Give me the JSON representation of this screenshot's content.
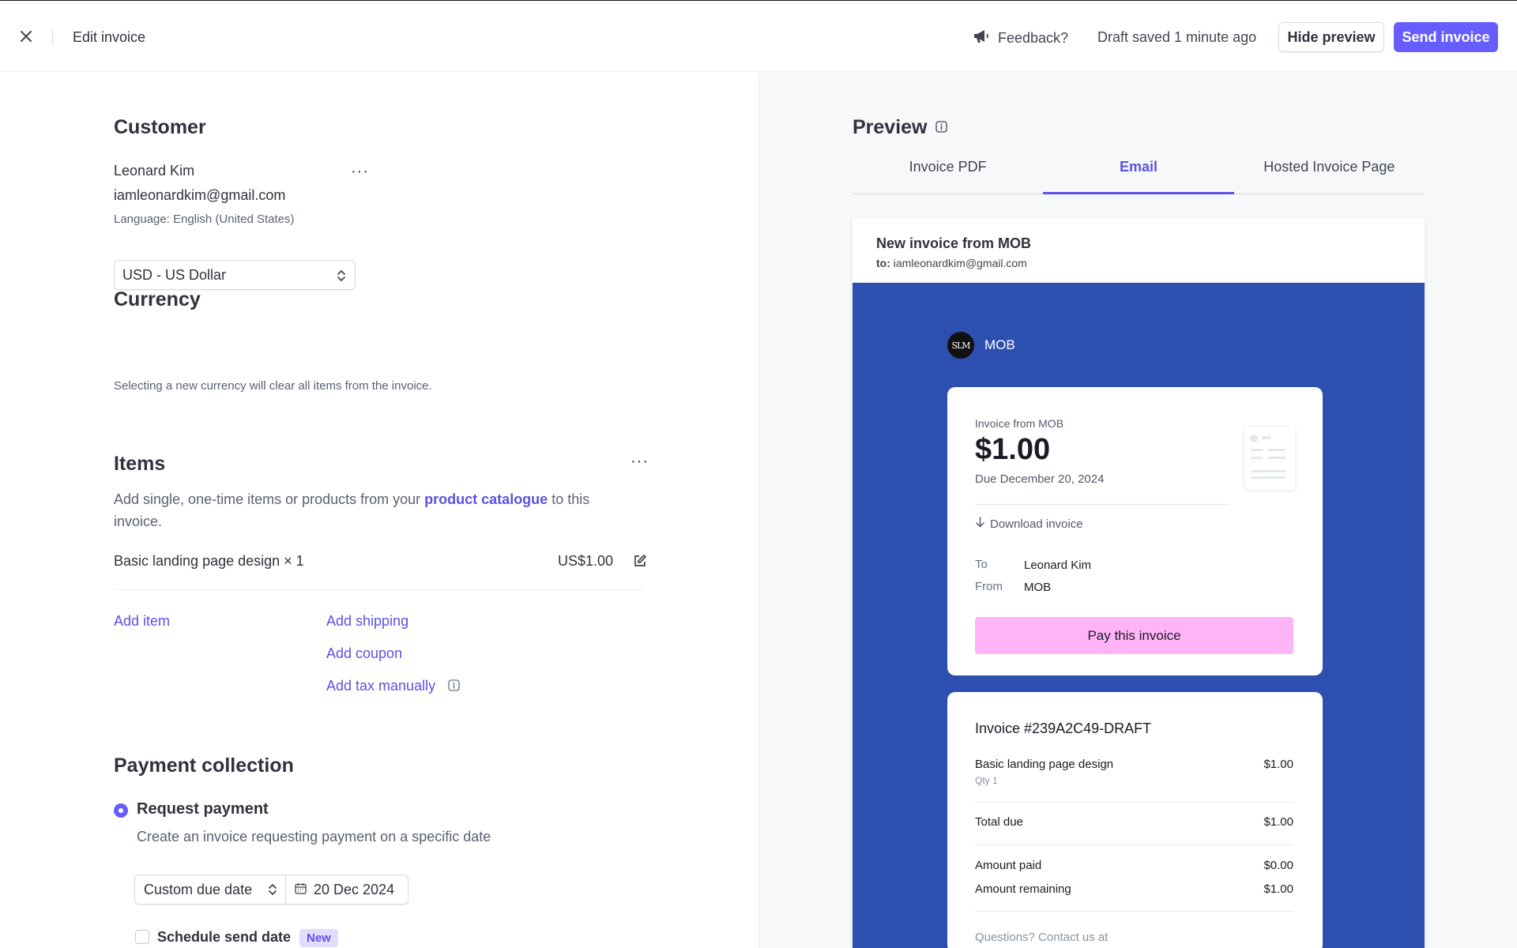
{
  "header": {
    "title": "Edit invoice",
    "feedback_label": "Feedback?",
    "draft_status": "Draft saved 1 minute ago",
    "hide_preview_label": "Hide preview",
    "send_invoice_label": "Send invoice"
  },
  "customer": {
    "heading": "Customer",
    "name": "Leonard Kim",
    "email": "iamleonardkim@gmail.com",
    "language": "Language: English (United States)",
    "menu": "···"
  },
  "currency": {
    "heading": "Currency",
    "selected": "USD - US Dollar",
    "help": "Selecting a new currency will clear all items from the invoice."
  },
  "items": {
    "heading": "Items",
    "menu": "···",
    "desc_before": "Add single, one-time items or products from your ",
    "desc_link": "product catalogue",
    "desc_after": " to this invoice.",
    "line_item": {
      "name": "Basic landing page design × 1",
      "amount": "US$1.00"
    },
    "add_item": "Add item",
    "add_shipping": "Add shipping",
    "add_coupon": "Add coupon",
    "add_tax": "Add tax manually"
  },
  "payment": {
    "heading": "Payment collection",
    "request_label": "Request payment",
    "request_desc": "Create an invoice requesting payment on a specific date",
    "due_type": "Custom due date",
    "due_date": "20 Dec 2024",
    "schedule_label": "Schedule send date",
    "new_badge": "New"
  },
  "preview": {
    "heading": "Preview",
    "tabs": [
      "Invoice PDF",
      "Email",
      "Hosted Invoice Page"
    ],
    "active_tab": "Email",
    "email_subject": "New invoice from MOB",
    "to_label": "to:",
    "to_value": "iamleonardkim@gmail.com",
    "brand_name": "MOB",
    "brand_logo_text": "SLM",
    "invoice_from": "Invoice from MOB",
    "amount": "$1.00",
    "due": "Due December 20, 2024",
    "download": "Download invoice",
    "to_row_label": "To",
    "to_row_value": "Leonard Kim",
    "from_row_label": "From",
    "from_row_value": "MOB",
    "pay_button": "Pay this invoice",
    "invoice_number": "Invoice #239A2C49-DRAFT",
    "line_name": "Basic landing page design",
    "line_qty": "Qty 1",
    "line_amount": "$1.00",
    "total_due_label": "Total due",
    "total_due": "$1.00",
    "amount_paid_label": "Amount paid",
    "amount_paid": "$0.00",
    "amount_remaining_label": "Amount remaining",
    "amount_remaining": "$1.00",
    "questions": "Questions? Contact us at"
  },
  "colors": {
    "accent": "#675dff",
    "email_bg": "#2c4fb0",
    "pay_button": "#ffb4f8"
  }
}
